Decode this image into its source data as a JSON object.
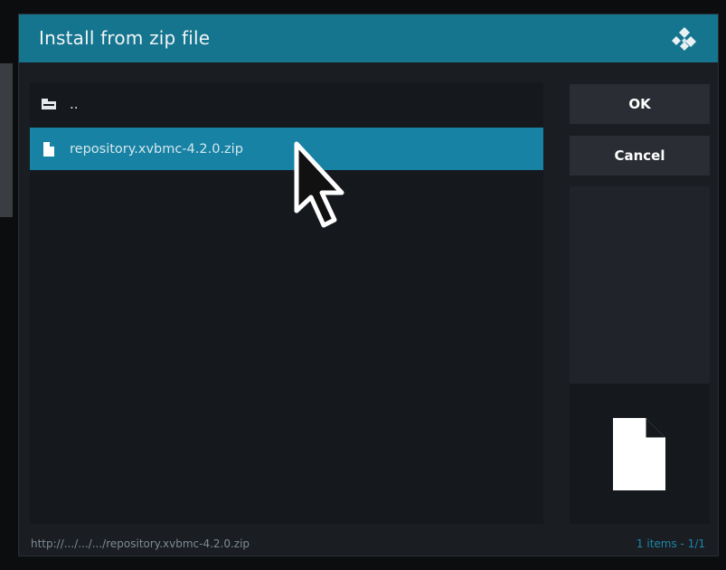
{
  "dialog": {
    "title": "Install from zip file",
    "logo_icon": "kodi-logo-icon"
  },
  "file_list": {
    "items": [
      {
        "label": "..",
        "icon": "parent-folder-icon"
      },
      {
        "label": "repository.xvbmc-4.2.0.zip",
        "icon": "file-icon",
        "selected": true
      }
    ]
  },
  "buttons": {
    "ok": "OK",
    "cancel": "Cancel"
  },
  "preview": {
    "icon": "file-icon"
  },
  "footer": {
    "path": "http://.../.../.../repository.xvbmc-4.2.0.zip",
    "count": "1 items - 1/1"
  },
  "colors": {
    "titlebar": "#15758f",
    "selection": "#1782a3",
    "dialog_bg": "#1a1e23",
    "panel_bg": "#15181d",
    "button_bg": "#2a2e34",
    "footer_count": "#1d86a8"
  }
}
